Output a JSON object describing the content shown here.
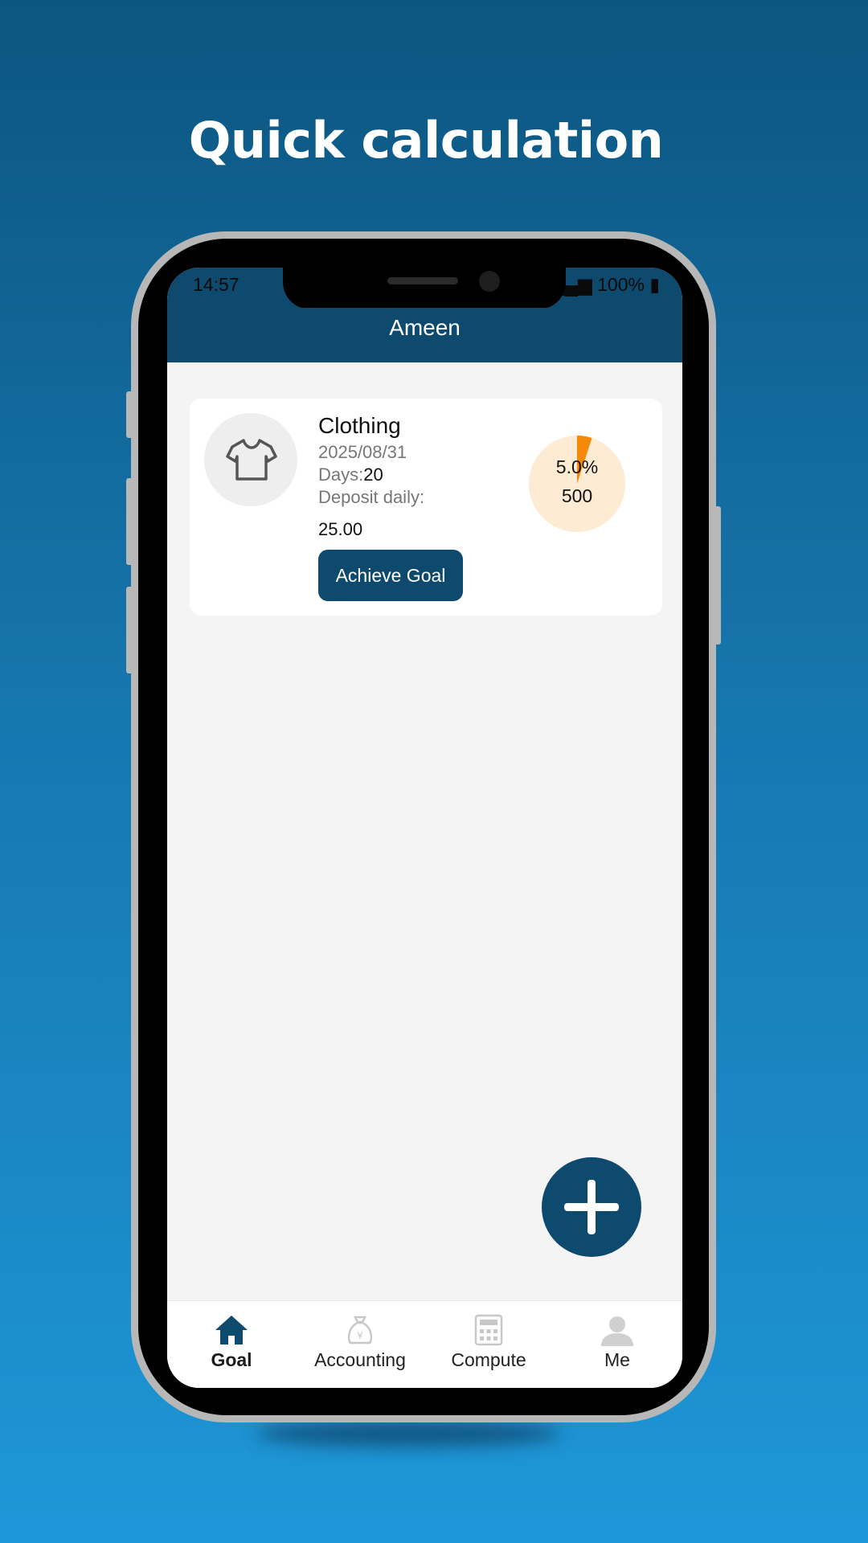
{
  "headline": "Quick calculation",
  "status_bar": {
    "time": "14:57",
    "battery": "100%"
  },
  "app_bar": {
    "title": "Ameen"
  },
  "goal_card": {
    "name": "Clothing",
    "date": "2025/08/31",
    "days_label": "Days:",
    "days_value": "20",
    "deposit_label": "Deposit daily:",
    "deposit_value": "25.00",
    "button_label": "Achieve Goal",
    "icon": "t-shirt-icon",
    "progress": {
      "percent_label": "5.0%",
      "fraction": 0.05,
      "target": "500"
    }
  },
  "fab": {
    "icon": "plus-icon"
  },
  "tabs": [
    {
      "label": "Goal",
      "icon": "home-icon",
      "active": true
    },
    {
      "label": "Accounting",
      "icon": "money-bag-icon",
      "active": false
    },
    {
      "label": "Compute",
      "icon": "calculator-icon",
      "active": false
    },
    {
      "label": "Me",
      "icon": "user-icon",
      "active": false
    }
  ],
  "colors": {
    "primary": "#0d4a6e",
    "pie_track": "#fdebd3",
    "pie_fill": "#f58a0a",
    "background_top": "#0c5580",
    "background_bottom": "#1e97d8"
  }
}
